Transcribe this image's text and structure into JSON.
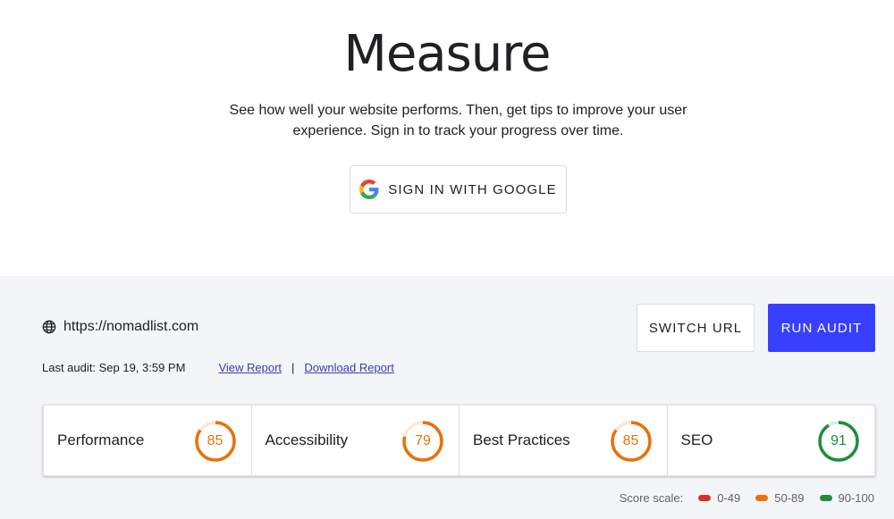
{
  "hero": {
    "title": "Measure",
    "subtitle": "See how well your website performs. Then, get tips to improve your user experience. Sign in to track your progress over time.",
    "signin_label": "SIGN IN WITH GOOGLE",
    "signin_icon": "google-g-icon"
  },
  "audit": {
    "url": "https://nomadlist.com",
    "url_icon": "globe-icon",
    "switch_label": "SWITCH URL",
    "run_label": "RUN AUDIT",
    "last_audit": "Last audit: Sep 19, 3:59 PM",
    "view_report": "View Report",
    "separator": "|",
    "download_report": "Download Report"
  },
  "scores": [
    {
      "name": "Performance",
      "value": 85,
      "display": "85",
      "color": "#e8710a",
      "track": "#fce8d4"
    },
    {
      "name": "Accessibility",
      "value": 79,
      "display": "79",
      "color": "#e8710a",
      "track": "#fce8d4"
    },
    {
      "name": "Best Practices",
      "value": 85,
      "display": "85",
      "color": "#e8710a",
      "track": "#fce8d4"
    },
    {
      "name": "SEO",
      "value": 91,
      "display": "91",
      "color": "#1e8e3e",
      "track": "#d6efdc"
    }
  ],
  "scale": {
    "label": "Score scale:",
    "ranges": [
      {
        "label": "0-49",
        "color": "#d93025"
      },
      {
        "label": "50-89",
        "color": "#e8710a"
      },
      {
        "label": "90-100",
        "color": "#1e8e3e"
      }
    ]
  },
  "colors": {
    "accent": "#3740ff",
    "panel_bg": "#f4f5f8",
    "link": "#3740b0"
  }
}
